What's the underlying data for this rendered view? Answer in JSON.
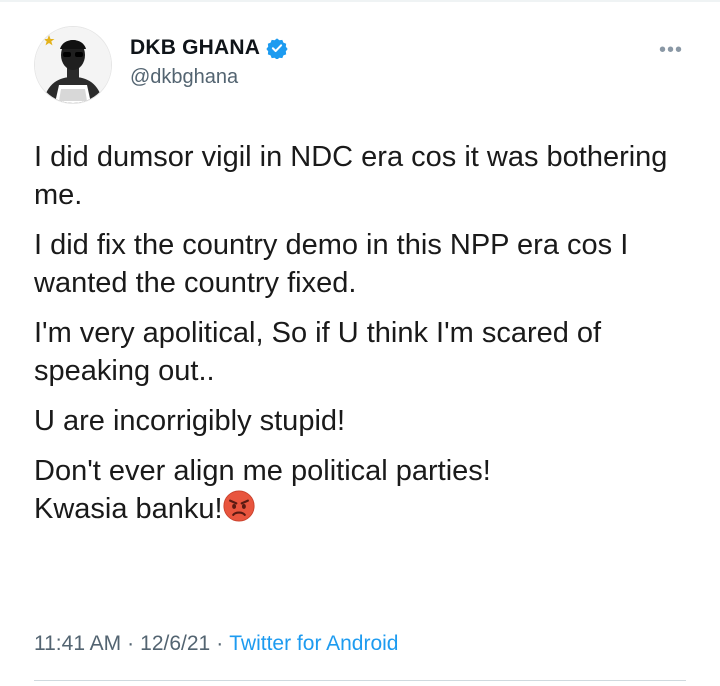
{
  "tweet": {
    "display_name": "DKB GHANA",
    "handle": "@dkbghana",
    "more_glyph": "•••",
    "paragraphs": [
      "I did dumsor vigil in NDC era cos it was bothering me.",
      "I did fix the country demo in this NPP era cos I wanted the country fixed.",
      "I'm very apolitical, So if U think I'm scared of speaking out..",
      "U are incorrigibly stupid!",
      "Don't ever align me political parties!"
    ],
    "last_line": "Kwasia banku!",
    "emoji": "angry-face",
    "time": "11:41 AM",
    "separator": "·",
    "date": "12/6/21",
    "source": "Twitter for Android"
  },
  "colors": {
    "accent": "#1d9bf0",
    "text": "#0f1419",
    "muted": "#536471",
    "border": "#cfd9de"
  },
  "icons": {
    "verified": "verified-badge-icon",
    "more": "more-options-icon",
    "emoji": "angry-face-emoji-icon"
  }
}
